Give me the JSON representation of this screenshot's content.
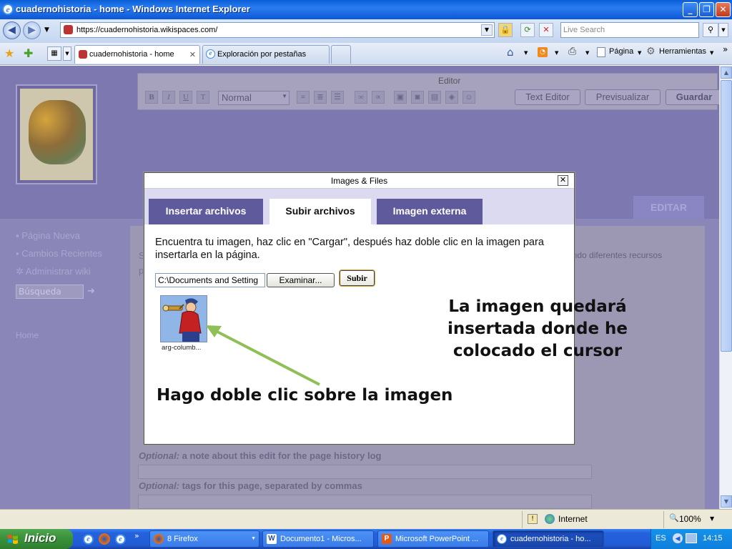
{
  "window": {
    "title": "cuadernohistoria - home - Windows Internet Explorer",
    "minimize": "_",
    "maximize": "❐",
    "close": "✕"
  },
  "addressbar": {
    "url": "https://cuadernohistoria.wikispaces.com/",
    "search_placeholder": "Live Search"
  },
  "tabs": {
    "items": [
      {
        "label": "cuadernohistoria - home",
        "close": "✕"
      },
      {
        "label": "Exploración por pestañas"
      }
    ]
  },
  "commandbar": {
    "page_label": "Página",
    "tools_label": "Herramientas",
    "more": "»"
  },
  "editor": {
    "title": "Editor",
    "format_value": "Normal",
    "text_editor_button": "Text Editor",
    "preview_button": "Previsualizar",
    "save_button": "Guardar",
    "bold": "B",
    "italic": "I",
    "underline": "U"
  },
  "page": {
    "edit_tab": "EDITAR",
    "sidebar": [
      {
        "label": "Página Nueva"
      },
      {
        "label": "Cambios Recientes"
      },
      {
        "label": "Administrar wiki"
      }
    ],
    "search_placeholder": "Búsqueda",
    "home_link": "Home",
    "bg_text_left1": "S",
    "bg_text_left2": "p",
    "bg_text_right": "endo diferentes recursos",
    "optional_prefix": "Optional:",
    "optional_note": " a note about this edit for the page history log",
    "optional_tags": " tags for this page, separated by commas"
  },
  "modal": {
    "title": "Images & Files",
    "close": "✕",
    "tabs": [
      "Insertar archivos",
      "Subir archivos",
      "Imagen externa"
    ],
    "active_tab": "Subir archivos",
    "instructions": "Encuentra tu imagen, haz clic en \"Cargar\", después haz doble clic en la imagen para insertarla en la página.",
    "file_path": "C:\\Documents and Setting",
    "browse_button": "Examinar...",
    "upload_button": "Subir",
    "thumbnail_caption": "arg-columb..."
  },
  "annotations": {
    "cursor_note": "La imagen quedará insertada donde he colocado el cursor",
    "doubleclick_note": "Hago doble clic sobre la imagen",
    "arrow_color": "#8fbf56"
  },
  "statusbar": {
    "zone": "Internet",
    "zoom": "100%"
  },
  "taskbar": {
    "start": "Inicio",
    "items": [
      {
        "label": "8 Firefox"
      },
      {
        "label": "Documento1 - Micros..."
      },
      {
        "label": "Microsoft PowerPoint ..."
      },
      {
        "label": "cuadernohistoria - ho..."
      }
    ],
    "language": "ES",
    "clock": "14:15"
  }
}
